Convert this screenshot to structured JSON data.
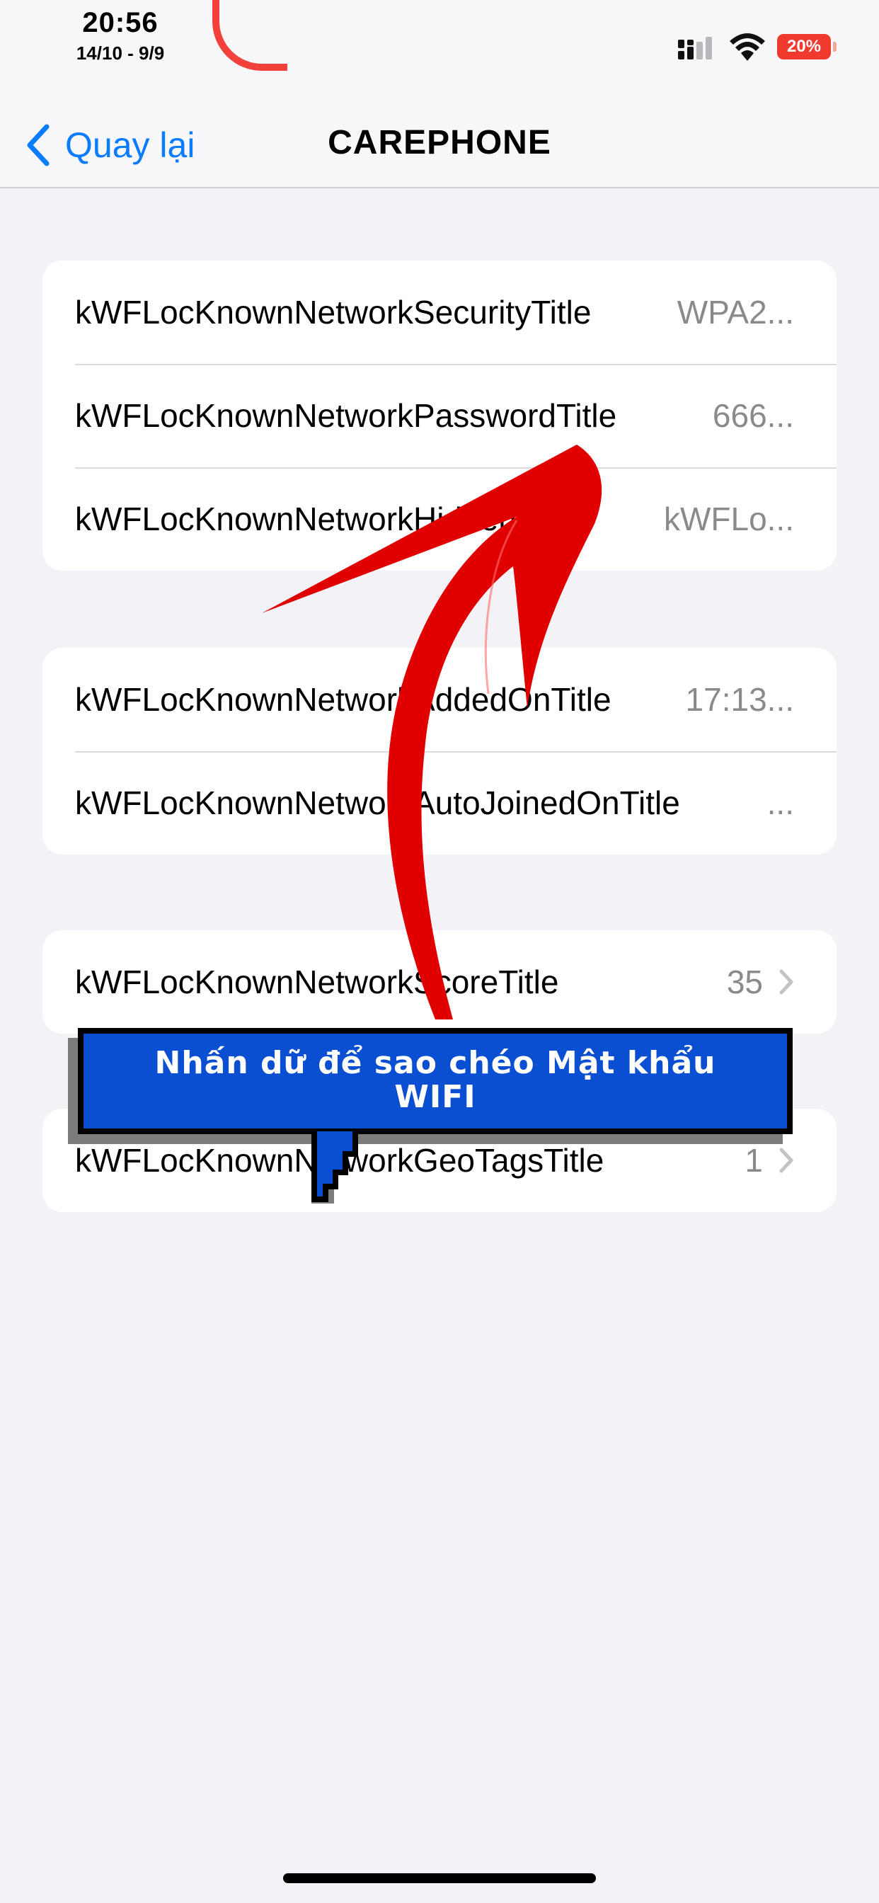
{
  "status_bar": {
    "time": "20:56",
    "date": "14/10 - 9/9",
    "battery": "20%",
    "signal_icon": "cellular-signal-icon",
    "wifi_icon": "wifi-icon"
  },
  "nav": {
    "back_label": "Quay lại",
    "title": "CAREPHONE"
  },
  "groups": [
    {
      "rows": [
        {
          "label": "kWFLocKnownNetworkSecurityTitle",
          "value": "WPA2..."
        },
        {
          "label": "kWFLocKnownNetworkPasswordTitle",
          "value": "666..."
        },
        {
          "label": "kWFLocKnownNetworkHiddenTitle",
          "value": "kWFLo..."
        }
      ]
    },
    {
      "rows": [
        {
          "label": "kWFLocKnownNetworkAddedOnTitle",
          "value": "17:13..."
        },
        {
          "label": "kWFLocKnownNetworkAutoJoinedOnTitle",
          "value": "..."
        }
      ]
    },
    {
      "rows": [
        {
          "label": "kWFLocKnownNetworkScoreTitle",
          "value": "35",
          "chevron": true
        }
      ]
    },
    {
      "rows": [
        {
          "label": "kWFLocKnownNetworkGeoTagsTitle",
          "value": "1",
          "chevron": true
        }
      ]
    }
  ],
  "tooltip": {
    "line1": "Nhấn dữ để sao chéo Mật khẩu",
    "line2": "WIFI"
  },
  "colors": {
    "accent": "#0a7cff",
    "arrow": "#e00000",
    "tooltip_bg": "#0a4fd2",
    "battery": "#f03a2e"
  }
}
